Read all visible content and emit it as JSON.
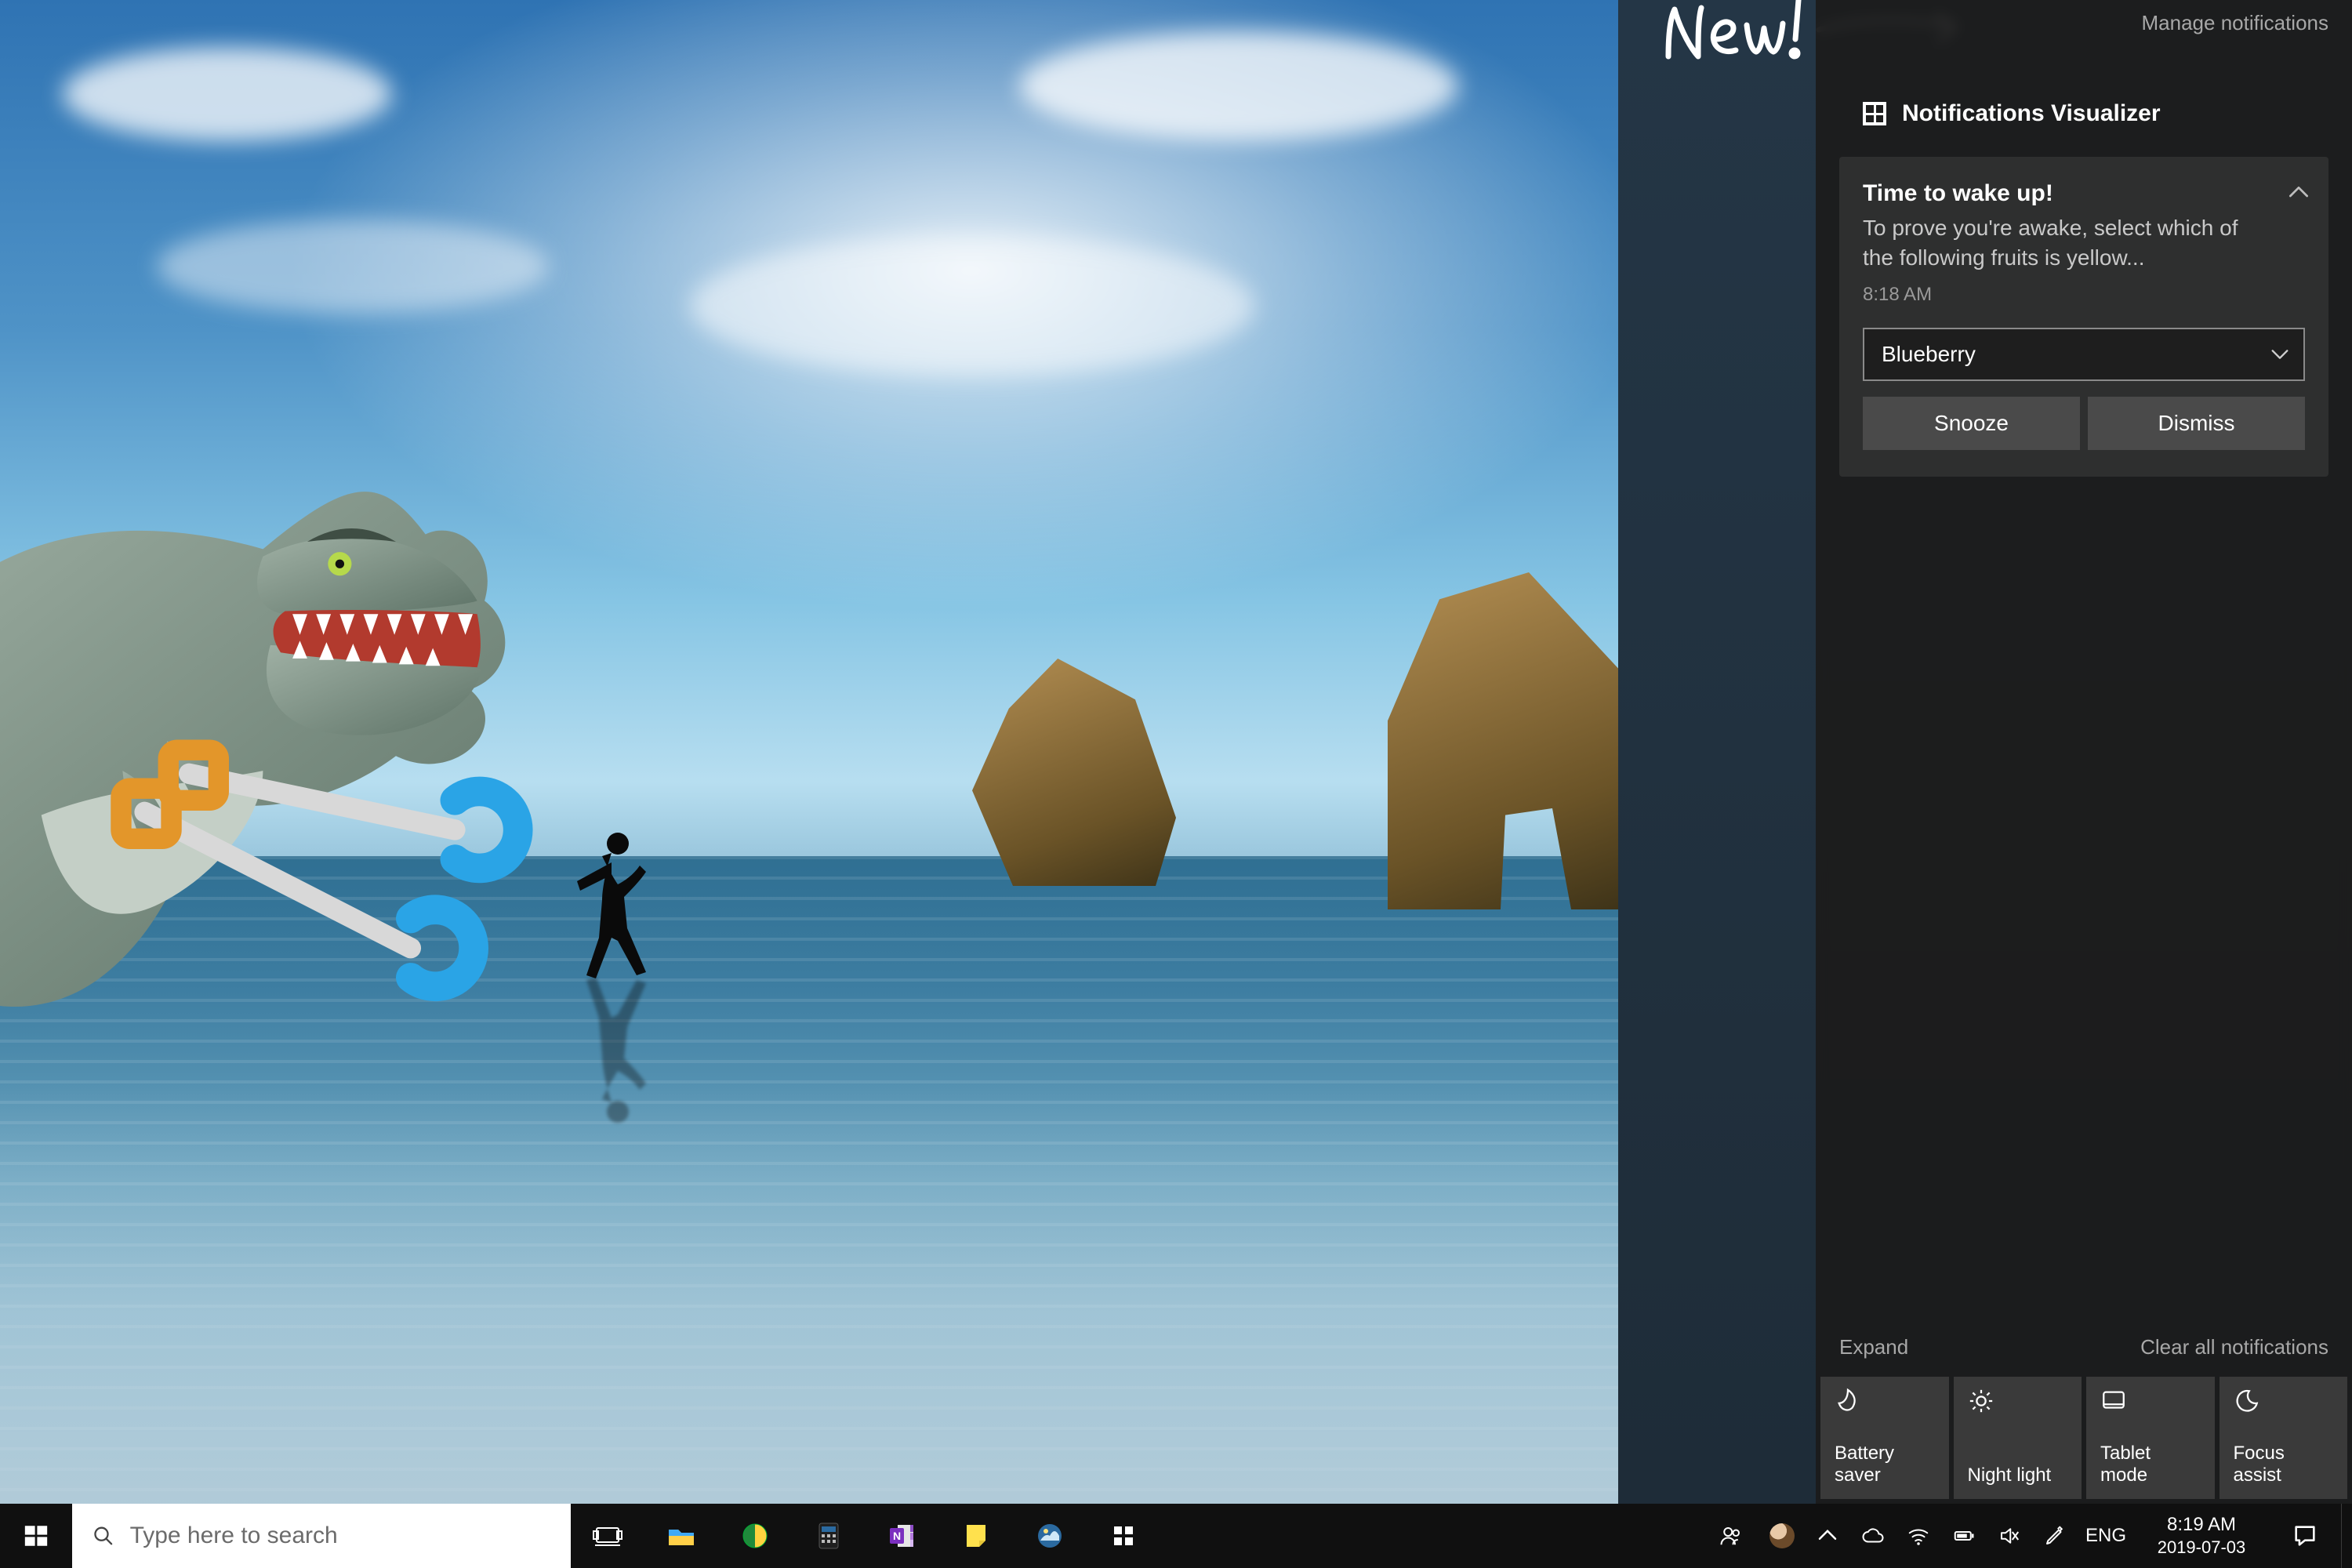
{
  "annotation": {
    "text": "New!"
  },
  "action_center": {
    "manage_label": "Manage notifications",
    "app_title": "Notifications Visualizer",
    "notification": {
      "title": "Time to wake up!",
      "body": "To prove you're awake, select which of the following fruits is yellow...",
      "time": "8:18 AM",
      "select_value": "Blueberry",
      "snooze": "Snooze",
      "dismiss": "Dismiss"
    },
    "expand": "Expand",
    "clear": "Clear all notifications",
    "quick_actions": [
      {
        "key": "battery_saver",
        "label": "Battery saver"
      },
      {
        "key": "night_light",
        "label": "Night light"
      },
      {
        "key": "tablet_mode",
        "label": "Tablet mode"
      },
      {
        "key": "focus_assist",
        "label": "Focus assist"
      }
    ]
  },
  "taskbar": {
    "search_placeholder": "Type here to search",
    "lang": "ENG",
    "time": "8:19 AM",
    "date": "2019-07-03"
  }
}
